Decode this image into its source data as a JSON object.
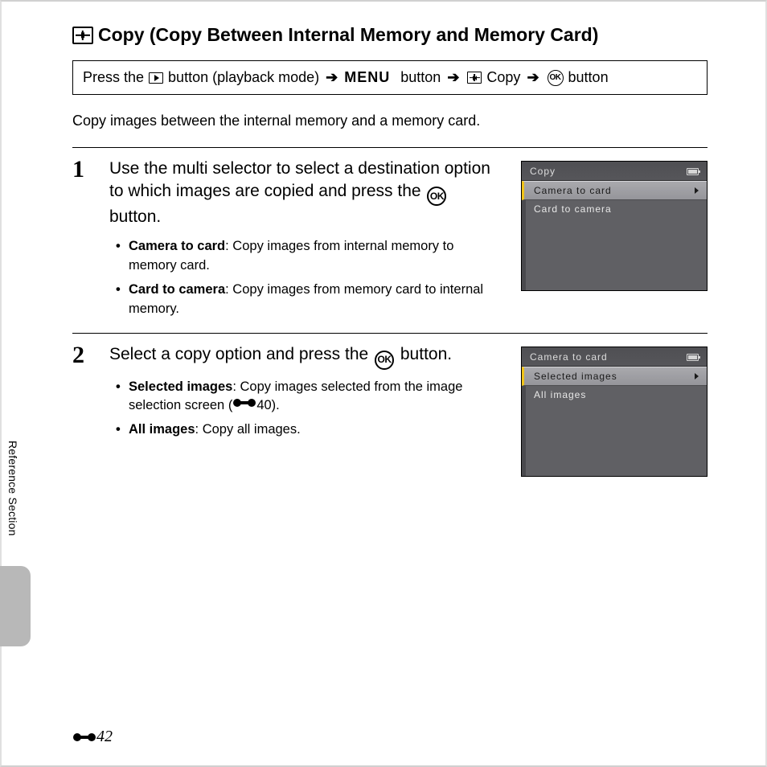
{
  "heading": "Copy (Copy Between Internal Memory and Memory Card)",
  "breadcrumb": {
    "press": "Press the",
    "playback_note": "button (playback mode)",
    "menu": "MENU",
    "button_word": "button",
    "copy_label": "Copy",
    "ok_label": "OK"
  },
  "intro": "Copy images between the internal memory and a memory card.",
  "steps": [
    {
      "num": "1",
      "title_a": "Use the multi selector to select a destination option to which images are copied and press the ",
      "title_b": " button.",
      "items": [
        {
          "term": "Camera to card",
          "desc": ": Copy images from internal memory to memory card."
        },
        {
          "term": "Card to camera",
          "desc": ": Copy images from memory card to internal memory."
        }
      ],
      "lcd": {
        "title": "Copy",
        "selected": "Camera to card",
        "other": "Card to camera"
      }
    },
    {
      "num": "2",
      "title_a": "Select a copy option and press the ",
      "title_b": " button.",
      "items": [
        {
          "term": "Selected images",
          "desc_a": ": Copy images selected from the image selection screen (",
          "ref": "40",
          "desc_b": ")."
        },
        {
          "term": "All images",
          "desc": ": Copy all images."
        }
      ],
      "lcd": {
        "title": "Camera to card",
        "selected": "Selected images",
        "other": "All images"
      }
    }
  ],
  "side_tab": "Reference Section",
  "page_number": "42"
}
